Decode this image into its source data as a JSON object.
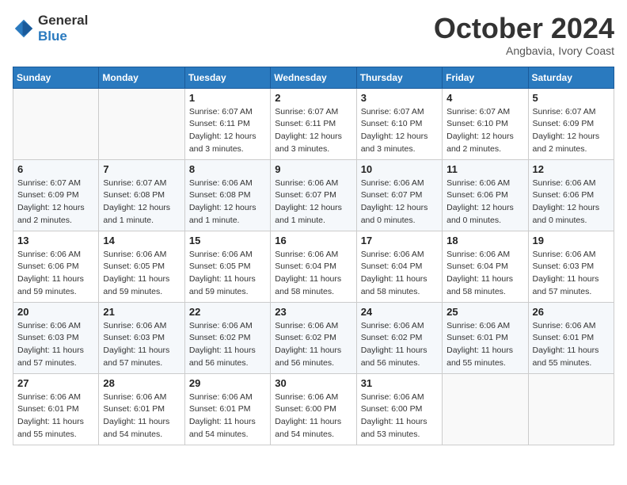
{
  "logo": {
    "line1": "General",
    "line2": "Blue"
  },
  "title": "October 2024",
  "subtitle": "Angbavia, Ivory Coast",
  "days_header": [
    "Sunday",
    "Monday",
    "Tuesday",
    "Wednesday",
    "Thursday",
    "Friday",
    "Saturday"
  ],
  "weeks": [
    [
      {
        "day": "",
        "info": ""
      },
      {
        "day": "",
        "info": ""
      },
      {
        "day": "1",
        "sunrise": "Sunrise: 6:07 AM",
        "sunset": "Sunset: 6:11 PM",
        "daylight": "Daylight: 12 hours and 3 minutes."
      },
      {
        "day": "2",
        "sunrise": "Sunrise: 6:07 AM",
        "sunset": "Sunset: 6:11 PM",
        "daylight": "Daylight: 12 hours and 3 minutes."
      },
      {
        "day": "3",
        "sunrise": "Sunrise: 6:07 AM",
        "sunset": "Sunset: 6:10 PM",
        "daylight": "Daylight: 12 hours and 3 minutes."
      },
      {
        "day": "4",
        "sunrise": "Sunrise: 6:07 AM",
        "sunset": "Sunset: 6:10 PM",
        "daylight": "Daylight: 12 hours and 2 minutes."
      },
      {
        "day": "5",
        "sunrise": "Sunrise: 6:07 AM",
        "sunset": "Sunset: 6:09 PM",
        "daylight": "Daylight: 12 hours and 2 minutes."
      }
    ],
    [
      {
        "day": "6",
        "sunrise": "Sunrise: 6:07 AM",
        "sunset": "Sunset: 6:09 PM",
        "daylight": "Daylight: 12 hours and 2 minutes."
      },
      {
        "day": "7",
        "sunrise": "Sunrise: 6:07 AM",
        "sunset": "Sunset: 6:08 PM",
        "daylight": "Daylight: 12 hours and 1 minute."
      },
      {
        "day": "8",
        "sunrise": "Sunrise: 6:06 AM",
        "sunset": "Sunset: 6:08 PM",
        "daylight": "Daylight: 12 hours and 1 minute."
      },
      {
        "day": "9",
        "sunrise": "Sunrise: 6:06 AM",
        "sunset": "Sunset: 6:07 PM",
        "daylight": "Daylight: 12 hours and 1 minute."
      },
      {
        "day": "10",
        "sunrise": "Sunrise: 6:06 AM",
        "sunset": "Sunset: 6:07 PM",
        "daylight": "Daylight: 12 hours and 0 minutes."
      },
      {
        "day": "11",
        "sunrise": "Sunrise: 6:06 AM",
        "sunset": "Sunset: 6:06 PM",
        "daylight": "Daylight: 12 hours and 0 minutes."
      },
      {
        "day": "12",
        "sunrise": "Sunrise: 6:06 AM",
        "sunset": "Sunset: 6:06 PM",
        "daylight": "Daylight: 12 hours and 0 minutes."
      }
    ],
    [
      {
        "day": "13",
        "sunrise": "Sunrise: 6:06 AM",
        "sunset": "Sunset: 6:06 PM",
        "daylight": "Daylight: 11 hours and 59 minutes."
      },
      {
        "day": "14",
        "sunrise": "Sunrise: 6:06 AM",
        "sunset": "Sunset: 6:05 PM",
        "daylight": "Daylight: 11 hours and 59 minutes."
      },
      {
        "day": "15",
        "sunrise": "Sunrise: 6:06 AM",
        "sunset": "Sunset: 6:05 PM",
        "daylight": "Daylight: 11 hours and 59 minutes."
      },
      {
        "day": "16",
        "sunrise": "Sunrise: 6:06 AM",
        "sunset": "Sunset: 6:04 PM",
        "daylight": "Daylight: 11 hours and 58 minutes."
      },
      {
        "day": "17",
        "sunrise": "Sunrise: 6:06 AM",
        "sunset": "Sunset: 6:04 PM",
        "daylight": "Daylight: 11 hours and 58 minutes."
      },
      {
        "day": "18",
        "sunrise": "Sunrise: 6:06 AM",
        "sunset": "Sunset: 6:04 PM",
        "daylight": "Daylight: 11 hours and 58 minutes."
      },
      {
        "day": "19",
        "sunrise": "Sunrise: 6:06 AM",
        "sunset": "Sunset: 6:03 PM",
        "daylight": "Daylight: 11 hours and 57 minutes."
      }
    ],
    [
      {
        "day": "20",
        "sunrise": "Sunrise: 6:06 AM",
        "sunset": "Sunset: 6:03 PM",
        "daylight": "Daylight: 11 hours and 57 minutes."
      },
      {
        "day": "21",
        "sunrise": "Sunrise: 6:06 AM",
        "sunset": "Sunset: 6:03 PM",
        "daylight": "Daylight: 11 hours and 57 minutes."
      },
      {
        "day": "22",
        "sunrise": "Sunrise: 6:06 AM",
        "sunset": "Sunset: 6:02 PM",
        "daylight": "Daylight: 11 hours and 56 minutes."
      },
      {
        "day": "23",
        "sunrise": "Sunrise: 6:06 AM",
        "sunset": "Sunset: 6:02 PM",
        "daylight": "Daylight: 11 hours and 56 minutes."
      },
      {
        "day": "24",
        "sunrise": "Sunrise: 6:06 AM",
        "sunset": "Sunset: 6:02 PM",
        "daylight": "Daylight: 11 hours and 56 minutes."
      },
      {
        "day": "25",
        "sunrise": "Sunrise: 6:06 AM",
        "sunset": "Sunset: 6:01 PM",
        "daylight": "Daylight: 11 hours and 55 minutes."
      },
      {
        "day": "26",
        "sunrise": "Sunrise: 6:06 AM",
        "sunset": "Sunset: 6:01 PM",
        "daylight": "Daylight: 11 hours and 55 minutes."
      }
    ],
    [
      {
        "day": "27",
        "sunrise": "Sunrise: 6:06 AM",
        "sunset": "Sunset: 6:01 PM",
        "daylight": "Daylight: 11 hours and 55 minutes."
      },
      {
        "day": "28",
        "sunrise": "Sunrise: 6:06 AM",
        "sunset": "Sunset: 6:01 PM",
        "daylight": "Daylight: 11 hours and 54 minutes."
      },
      {
        "day": "29",
        "sunrise": "Sunrise: 6:06 AM",
        "sunset": "Sunset: 6:01 PM",
        "daylight": "Daylight: 11 hours and 54 minutes."
      },
      {
        "day": "30",
        "sunrise": "Sunrise: 6:06 AM",
        "sunset": "Sunset: 6:00 PM",
        "daylight": "Daylight: 11 hours and 54 minutes."
      },
      {
        "day": "31",
        "sunrise": "Sunrise: 6:06 AM",
        "sunset": "Sunset: 6:00 PM",
        "daylight": "Daylight: 11 hours and 53 minutes."
      },
      {
        "day": "",
        "info": ""
      },
      {
        "day": "",
        "info": ""
      }
    ]
  ]
}
